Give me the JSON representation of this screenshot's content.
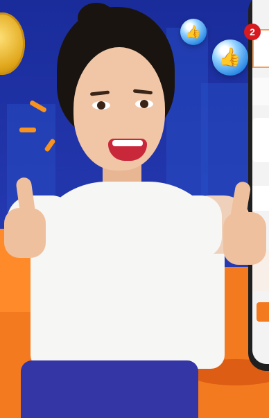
{
  "notification": {
    "badge_count": "2"
  },
  "colors": {
    "background_blue": "#1d2f9a",
    "accent_orange": "#f47a20",
    "badge_red": "#d71920"
  },
  "icons": [
    "coin-icon",
    "like-bubble-icon",
    "like-bubble-icon"
  ]
}
